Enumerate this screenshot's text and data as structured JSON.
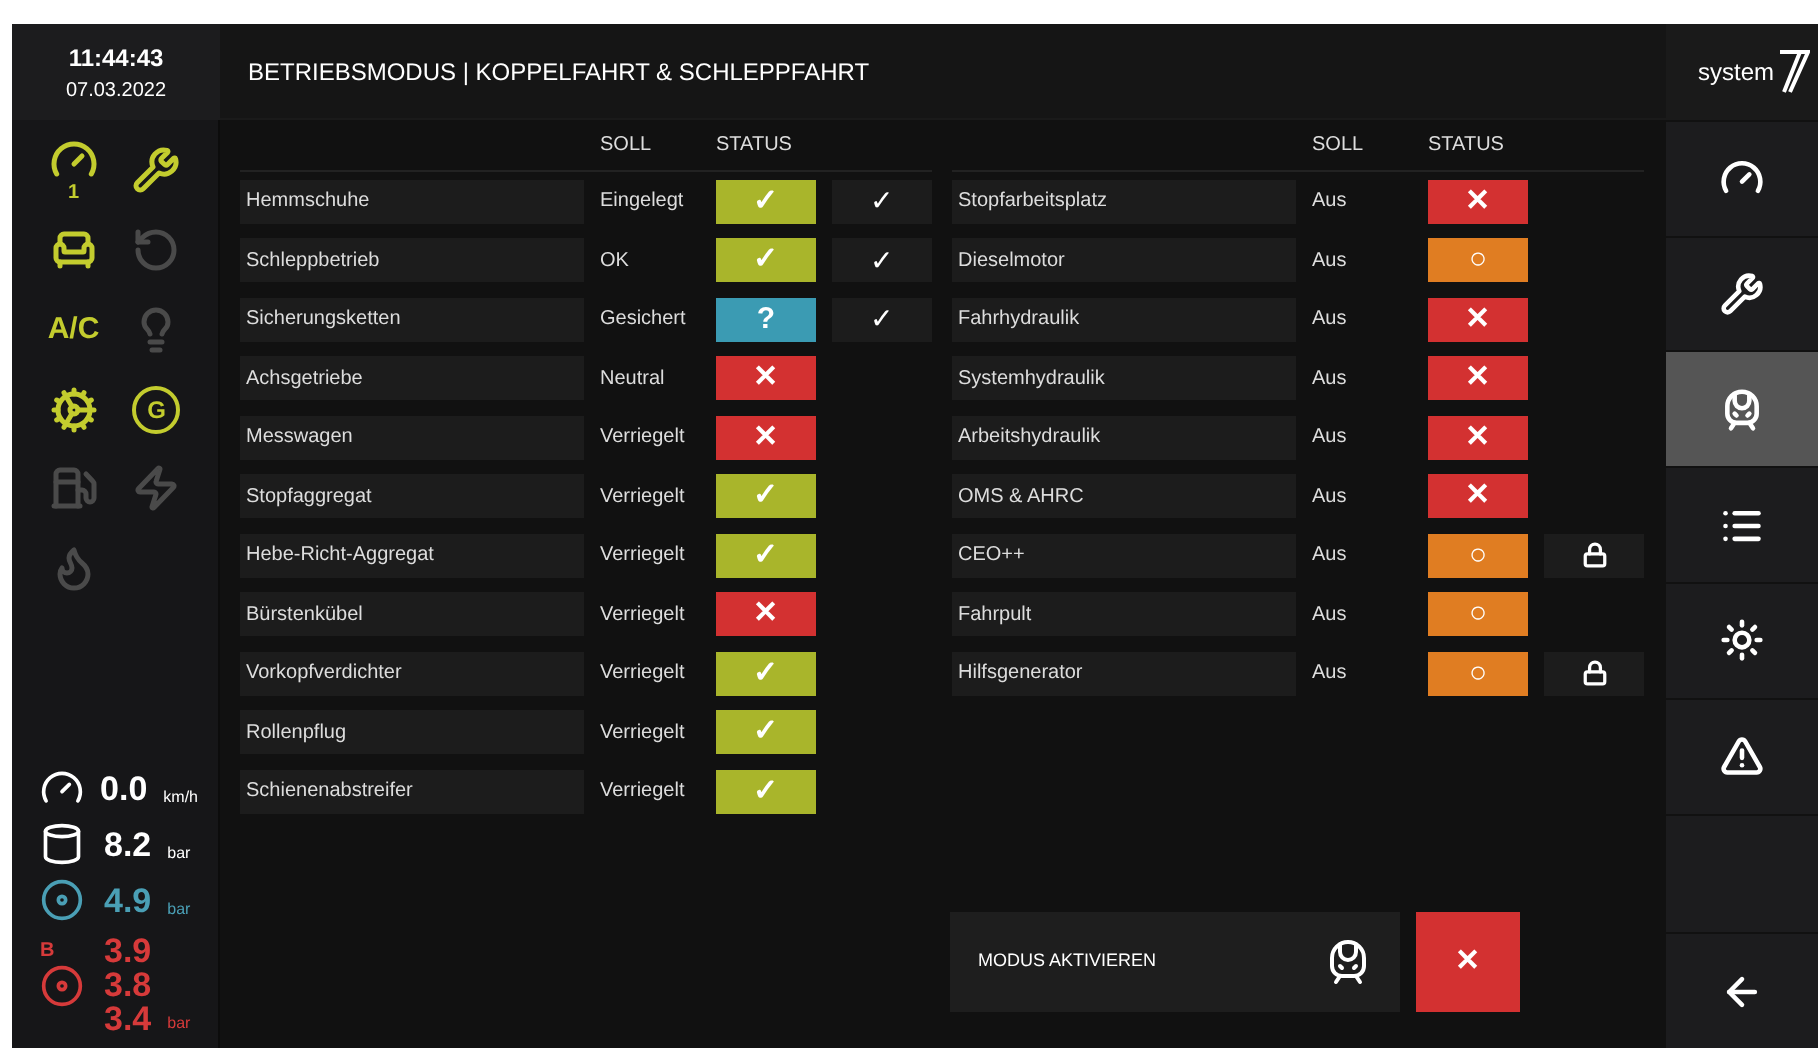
{
  "clock": {
    "time": "11:44:43",
    "date": "07.03.2022"
  },
  "title": "BETRIEBSMODUS | KOPPELFAHRT & SCHLEPPFAHRT",
  "logo": {
    "text": "system"
  },
  "indicators": [
    {
      "kind": "gauge",
      "active": true,
      "label": "1"
    },
    {
      "kind": "tools",
      "active": true
    },
    {
      "kind": "seats",
      "active": true
    },
    {
      "kind": "lock-rotate",
      "active": false
    },
    {
      "kind": "text",
      "active": true,
      "label": "A/C"
    },
    {
      "kind": "lights",
      "active": false
    },
    {
      "kind": "engine",
      "active": true
    },
    {
      "kind": "generator",
      "active": true,
      "label": "G"
    },
    {
      "kind": "fuel",
      "active": false
    },
    {
      "kind": "bolt",
      "active": false
    },
    {
      "kind": "flame",
      "active": false
    }
  ],
  "readings": [
    {
      "kind": "speed",
      "values": [
        "0.0"
      ],
      "unit": "km/h",
      "color": "#ffffff"
    },
    {
      "kind": "tank",
      "values": [
        "8.2"
      ],
      "unit": "bar",
      "color": "#ffffff"
    },
    {
      "kind": "brake",
      "values": [
        "4.9"
      ],
      "unit": "bar",
      "color": "#4a9fb5"
    },
    {
      "kind": "brake-b",
      "label": "B",
      "values": [
        "3.9",
        "3.8",
        "3.4"
      ],
      "unit": "bar",
      "color": "#d63a3a"
    }
  ],
  "tables": [
    {
      "columns": [
        "SOLL",
        "STATUS"
      ],
      "rows": [
        {
          "name": "Hemmschuhe",
          "soll": "Eingelegt",
          "kind": "ok",
          "symbol": "✓",
          "confirm": "✓"
        },
        {
          "name": "Schleppbetrieb",
          "soll": "OK",
          "kind": "ok",
          "symbol": "✓",
          "confirm": "✓"
        },
        {
          "name": "Sicherungsketten",
          "soll": "Gesichert",
          "kind": "unknown",
          "symbol": "?",
          "confirm": "✓"
        },
        {
          "name": "Achsgetriebe",
          "soll": "Neutral",
          "kind": "fail",
          "symbol": "✕"
        },
        {
          "name": "Messwagen",
          "soll": "Verriegelt",
          "kind": "fail",
          "symbol": "✕"
        },
        {
          "name": "Stopfaggregat",
          "soll": "Verriegelt",
          "kind": "ok",
          "symbol": "✓"
        },
        {
          "name": "Hebe-Richt-Aggregat",
          "soll": "Verriegelt",
          "kind": "ok",
          "symbol": "✓"
        },
        {
          "name": "Bürstenkübel",
          "soll": "Verriegelt",
          "kind": "fail",
          "symbol": "✕"
        },
        {
          "name": "Vorkopfverdichter",
          "soll": "Verriegelt",
          "kind": "ok",
          "symbol": "✓"
        },
        {
          "name": "Rollenpflug",
          "soll": "Verriegelt",
          "kind": "ok",
          "symbol": "✓"
        },
        {
          "name": "Schienenabstreifer",
          "soll": "Verriegelt",
          "kind": "ok",
          "symbol": "✓"
        }
      ]
    },
    {
      "columns": [
        "SOLL",
        "STATUS"
      ],
      "rows": [
        {
          "name": "Stopfarbeitsplatz",
          "soll": "Aus",
          "kind": "fail",
          "symbol": "✕",
          "locked": false
        },
        {
          "name": "Dieselmotor",
          "soll": "Aus",
          "kind": "pending",
          "symbol": "○",
          "locked": false
        },
        {
          "name": "Fahrhydraulik",
          "soll": "Aus",
          "kind": "fail",
          "symbol": "✕",
          "locked": false
        },
        {
          "name": "Systemhydraulik",
          "soll": "Aus",
          "kind": "fail",
          "symbol": "✕",
          "locked": false
        },
        {
          "name": "Arbeitshydraulik",
          "soll": "Aus",
          "kind": "fail",
          "symbol": "✕",
          "locked": false
        },
        {
          "name": "OMS & AHRC",
          "soll": "Aus",
          "kind": "fail",
          "symbol": "✕",
          "locked": false
        },
        {
          "name": "CEO++",
          "soll": "Aus",
          "kind": "pending",
          "symbol": "○",
          "locked": true
        },
        {
          "name": "Fahrpult",
          "soll": "Aus",
          "kind": "pending",
          "symbol": "○",
          "locked": false
        },
        {
          "name": "Hilfsgenerator",
          "soll": "Aus",
          "kind": "pending",
          "symbol": "○",
          "locked": true
        }
      ]
    }
  ],
  "activate": {
    "label": "MODUS AKTIVIEREN",
    "cancel": "✕"
  },
  "nav": [
    {
      "kind": "gauge",
      "selected": false
    },
    {
      "kind": "tools",
      "selected": false
    },
    {
      "kind": "train",
      "selected": true
    },
    {
      "kind": "list",
      "selected": false
    },
    {
      "kind": "sun",
      "selected": false
    },
    {
      "kind": "warning",
      "selected": false
    },
    {
      "kind": "empty",
      "selected": false
    },
    {
      "kind": "back",
      "selected": false
    }
  ]
}
